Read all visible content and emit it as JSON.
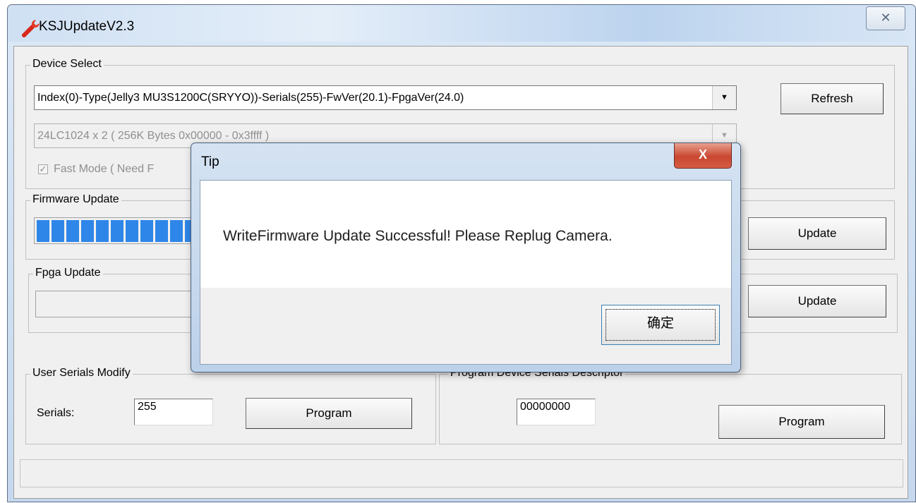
{
  "window": {
    "title": "KSJUpdateV2.3",
    "close_glyph": "✕",
    "icon": "wrench-icon"
  },
  "device_select": {
    "legend": "Device Select",
    "device_combo_value": "Index(0)-Type(Jelly3 MU3S1200C(SRYYO))-Serials(255)-FwVer(20.1)-FpgaVer(24.0)",
    "eeprom_combo_value": "24LC1024 x 2 ( 256K Bytes 0x00000 - 0x3ffff )",
    "fast_mode_label": "Fast Mode ( Need F",
    "fast_mode_checked": true,
    "refresh_label": "Refresh"
  },
  "firmware_update": {
    "legend": "Firmware Update",
    "update_label": "Update",
    "progress_segments": 8
  },
  "fpga_update": {
    "legend": "Fpga Update",
    "update_label": "Update"
  },
  "user_serials": {
    "legend": "User Serials Modify",
    "serials_label": "Serials:",
    "serials_value": "255",
    "program_label": "Program"
  },
  "program_descriptor": {
    "legend": "Program Device Serials Descriptor",
    "descriptor_value": "00000000",
    "program_label": "Program"
  },
  "dialog": {
    "title": "Tip",
    "close_glyph": "X",
    "message": "WriteFirmware Update Successful! Please Replug Camera.",
    "ok_label": "确定"
  }
}
